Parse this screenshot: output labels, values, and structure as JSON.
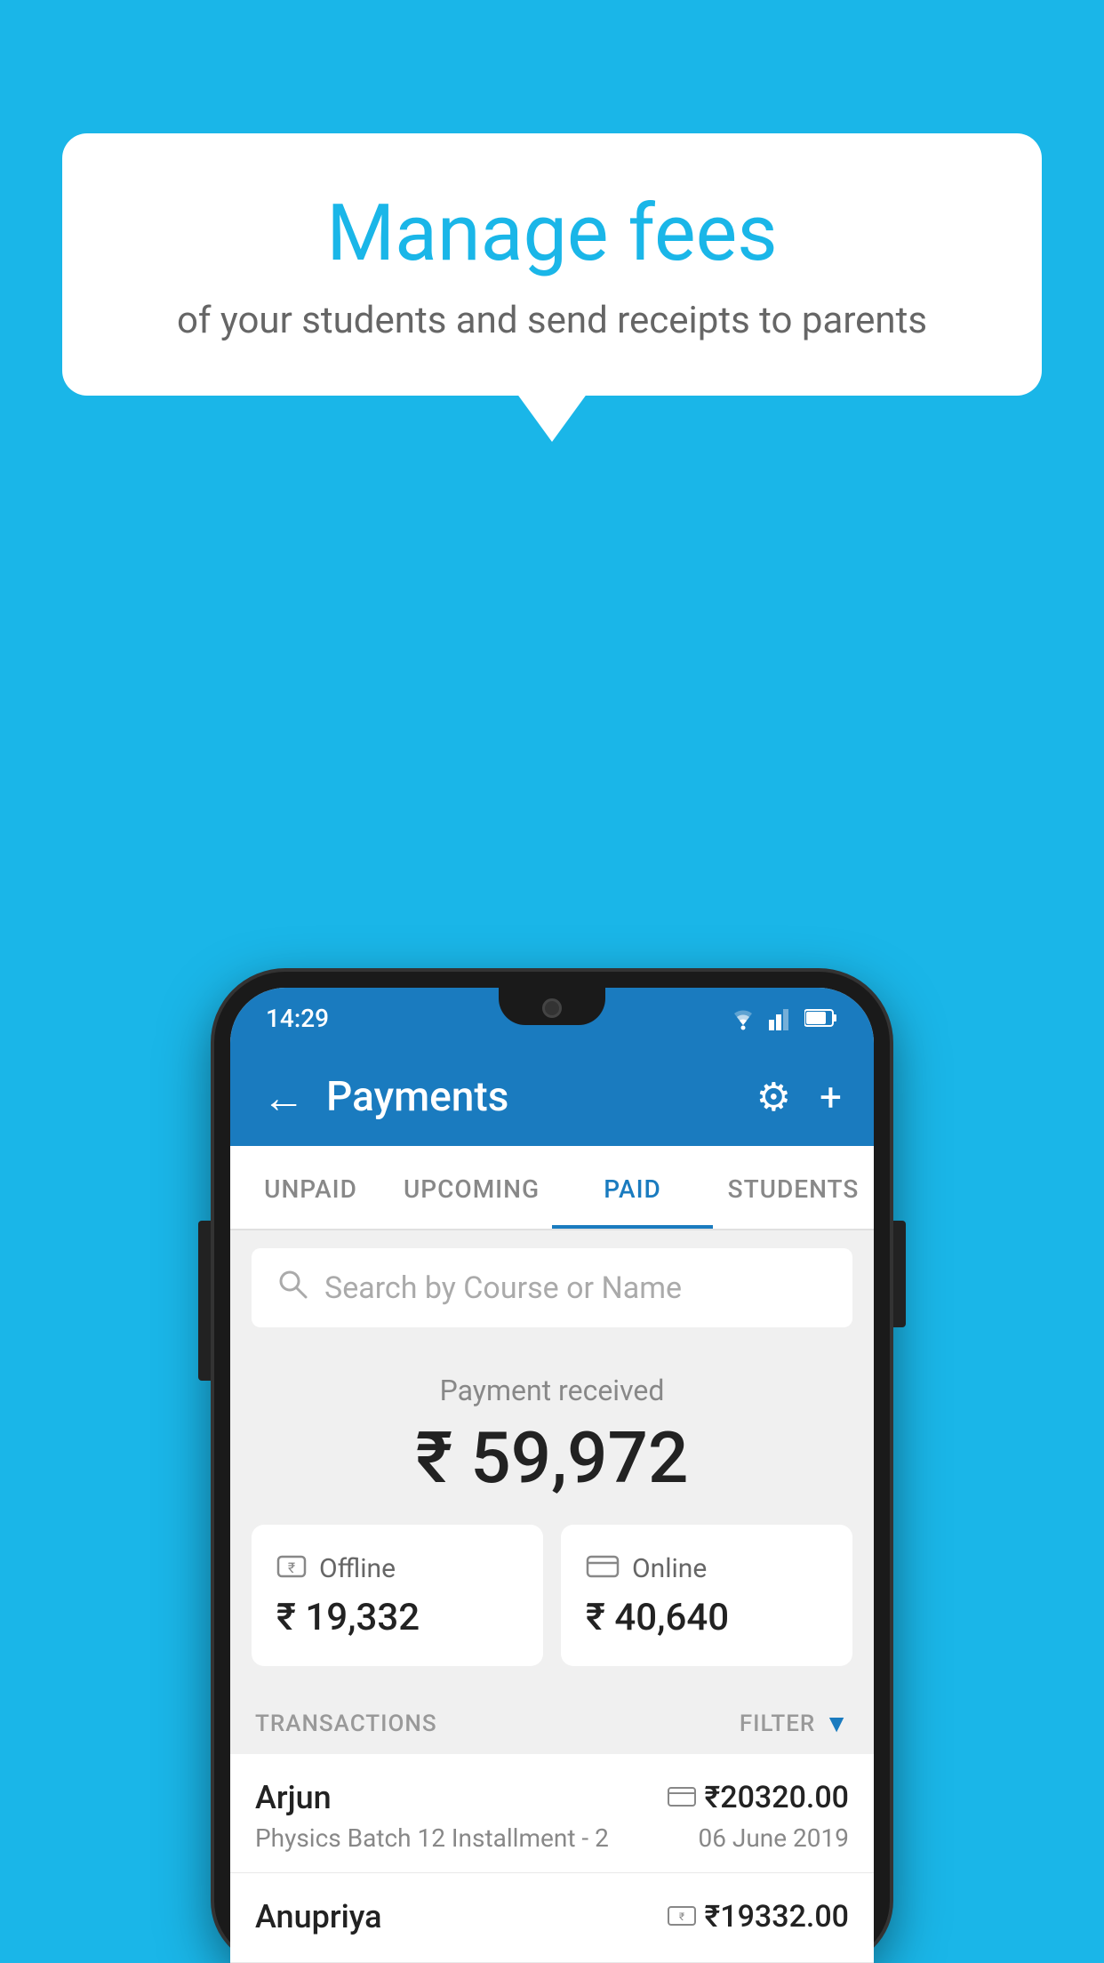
{
  "background_color": "#1ab6e8",
  "speech_bubble": {
    "title": "Manage fees",
    "subtitle": "of your students and send receipts to parents"
  },
  "status_bar": {
    "time": "14:29"
  },
  "app_bar": {
    "title": "Payments",
    "back_label": "←",
    "settings_label": "⚙",
    "add_label": "+"
  },
  "tabs": [
    {
      "label": "UNPAID",
      "active": false
    },
    {
      "label": "UPCOMING",
      "active": false
    },
    {
      "label": "PAID",
      "active": true
    },
    {
      "label": "STUDENTS",
      "active": false
    }
  ],
  "search": {
    "placeholder": "Search by Course or Name"
  },
  "payment_received": {
    "label": "Payment received",
    "amount": "₹ 59,972"
  },
  "payment_cards": [
    {
      "type": "Offline",
      "amount": "₹ 19,332",
      "icon": "rupee-card-icon"
    },
    {
      "type": "Online",
      "amount": "₹ 40,640",
      "icon": "credit-card-icon"
    }
  ],
  "transactions_header": {
    "label": "TRANSACTIONS",
    "filter_label": "FILTER"
  },
  "transactions": [
    {
      "name": "Arjun",
      "amount": "₹20320.00",
      "course": "Physics Batch 12 Installment - 2",
      "date": "06 June 2019",
      "payment_type": "online"
    },
    {
      "name": "Anupriya",
      "amount": "₹19332.00",
      "course": "",
      "date": "",
      "payment_type": "offline"
    }
  ]
}
